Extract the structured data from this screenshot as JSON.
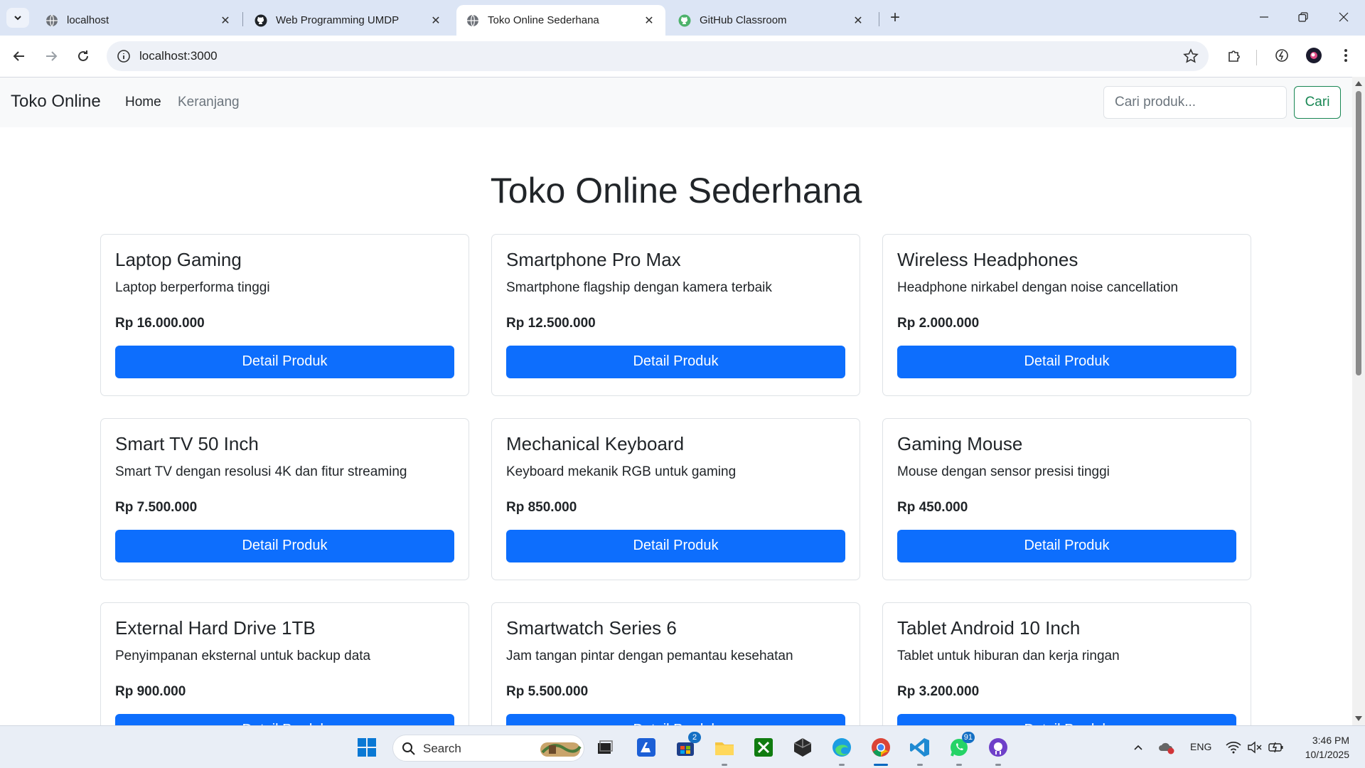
{
  "browser": {
    "tabs": [
      {
        "title": "localhost",
        "icon": "globe-icon",
        "active": false
      },
      {
        "title": "Web Programming UMDP",
        "icon": "github-icon",
        "active": false
      },
      {
        "title": "Toko Online Sederhana",
        "icon": "globe-icon",
        "active": true
      },
      {
        "title": "GitHub Classroom",
        "icon": "github-classroom-icon",
        "active": false
      }
    ],
    "new_tab": "+",
    "url": "localhost:3000"
  },
  "site": {
    "brand": "Toko Online",
    "nav": {
      "home": "Home",
      "cart": "Keranjang"
    },
    "search": {
      "placeholder": "Cari produk...",
      "button": "Cari"
    },
    "page_title": "Toko Online Sederhana"
  },
  "products": [
    {
      "name": "Laptop Gaming",
      "desc": "Laptop berperforma tinggi",
      "price": "Rp 16.000.000",
      "button": "Detail Produk"
    },
    {
      "name": "Smartphone Pro Max",
      "desc": "Smartphone flagship dengan kamera terbaik",
      "price": "Rp 12.500.000",
      "button": "Detail Produk"
    },
    {
      "name": "Wireless Headphones",
      "desc": "Headphone nirkabel dengan noise cancellation",
      "price": "Rp 2.000.000",
      "button": "Detail Produk"
    },
    {
      "name": "Smart TV 50 Inch",
      "desc": "Smart TV dengan resolusi 4K dan fitur streaming",
      "price": "Rp 7.500.000",
      "button": "Detail Produk"
    },
    {
      "name": "Mechanical Keyboard",
      "desc": "Keyboard mekanik RGB untuk gaming",
      "price": "Rp 850.000",
      "button": "Detail Produk"
    },
    {
      "name": "Gaming Mouse",
      "desc": "Mouse dengan sensor presisi tinggi",
      "price": "Rp 450.000",
      "button": "Detail Produk"
    },
    {
      "name": "External Hard Drive 1TB",
      "desc": "Penyimpanan eksternal untuk backup data",
      "price": "Rp 900.000",
      "button": "Detail Produk"
    },
    {
      "name": "Smartwatch Series 6",
      "desc": "Jam tangan pintar dengan pemantau kesehatan",
      "price": "Rp 5.500.000",
      "button": "Detail Produk"
    },
    {
      "name": "Tablet Android 10 Inch",
      "desc": "Tablet untuk hiburan dan kerja ringan",
      "price": "Rp 3.200.000",
      "button": "Detail Produk"
    }
  ],
  "taskbar": {
    "search_label": "Search",
    "store_badge": "2",
    "whatsapp_badge": "91",
    "language": "ENG",
    "time": "3:46 PM",
    "date": "10/1/2025"
  },
  "colors": {
    "primary": "#0d6efd",
    "success": "#198754",
    "navbar_bg": "#f8f9fa",
    "chrome_bg": "#dce5f5"
  }
}
